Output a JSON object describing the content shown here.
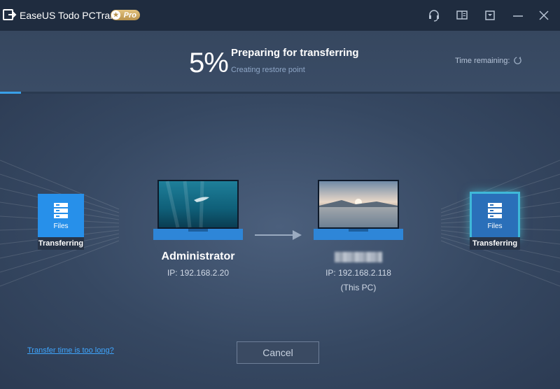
{
  "app": {
    "title": "EaseUS Todo PCTrans",
    "badge": "Pro"
  },
  "progress": {
    "percent": 5,
    "percent_label": "5%",
    "title": "Preparing for transferring",
    "subtitle": "Creating restore point"
  },
  "time_remaining": {
    "label": "Time remaining:"
  },
  "source": {
    "card_label": "Files",
    "tag": "Transferring",
    "name": "Administrator",
    "ip": "IP: 192.168.2.20"
  },
  "target": {
    "card_label": "Files",
    "tag": "Transferring",
    "ip": "IP: 192.168.2.118",
    "note": "(This PC)"
  },
  "footer": {
    "help_link": "Transfer time is too long?",
    "cancel_label": "Cancel"
  },
  "colors": {
    "accent": "#3aa0e8",
    "card": "#2790ea",
    "link": "#3fa6ff"
  },
  "icons": [
    "logo-icon",
    "support-icon",
    "feedback-icon",
    "menu-icon",
    "minimize-icon",
    "close-icon",
    "refresh-icon",
    "server-icon",
    "arrow-right-icon"
  ]
}
